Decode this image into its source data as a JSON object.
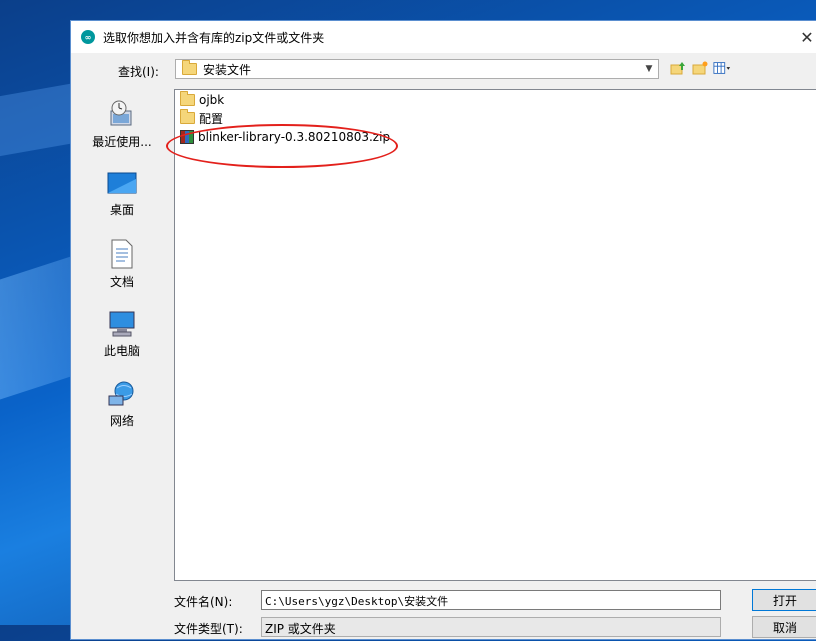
{
  "dialog": {
    "title": "选取你想加入并含有库的zip文件或文件夹",
    "close_label": "✕"
  },
  "lookin": {
    "label": "查找(I):",
    "value": "安装文件"
  },
  "places": [
    {
      "label": "最近使用...",
      "icon": "recent-items-icon"
    },
    {
      "label": "桌面",
      "icon": "desktop-icon"
    },
    {
      "label": "文档",
      "icon": "documents-icon"
    },
    {
      "label": "此电脑",
      "icon": "computer-icon"
    },
    {
      "label": "网络",
      "icon": "network-icon"
    }
  ],
  "files": [
    {
      "name": "ojbk",
      "type": "folder"
    },
    {
      "name": "配置",
      "type": "folder"
    },
    {
      "name": "blinker-library-0.3.80210803.zip",
      "type": "zip"
    }
  ],
  "filename": {
    "label": "文件名(N):",
    "value": "C:\\Users\\ygz\\Desktop\\安装文件"
  },
  "filetype": {
    "label": "文件类型(T):",
    "value": "ZIP 或文件夹"
  },
  "buttons": {
    "open": "打开",
    "cancel": "取消"
  },
  "colors": {
    "highlight": "#e3201b",
    "accent": "#0078d7"
  }
}
